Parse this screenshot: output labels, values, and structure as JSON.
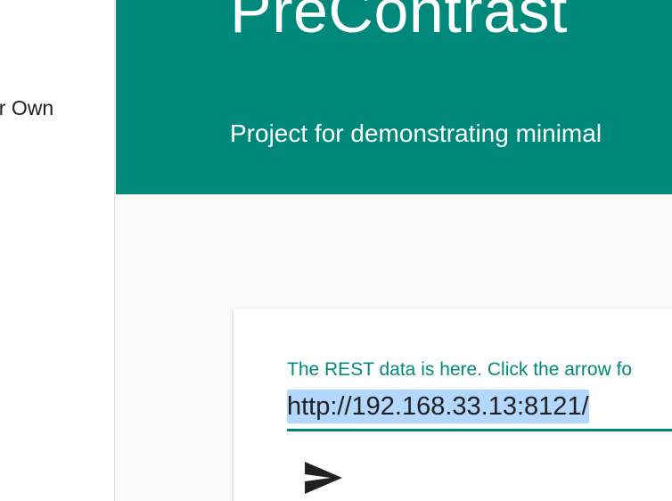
{
  "sidebar": {
    "items": [
      {
        "label": "ur Own"
      }
    ]
  },
  "header": {
    "title": "PreContrast",
    "subtitle": "Project for demonstrating minimal"
  },
  "card": {
    "field_label": "The REST data is here. Click the arrow fo",
    "url_value": "http://192.168.33.13:8121/",
    "send_icon": "send-icon"
  },
  "colors": {
    "accent": "#00897b",
    "selection": "#b3d7fd",
    "background": "#fafafa"
  }
}
